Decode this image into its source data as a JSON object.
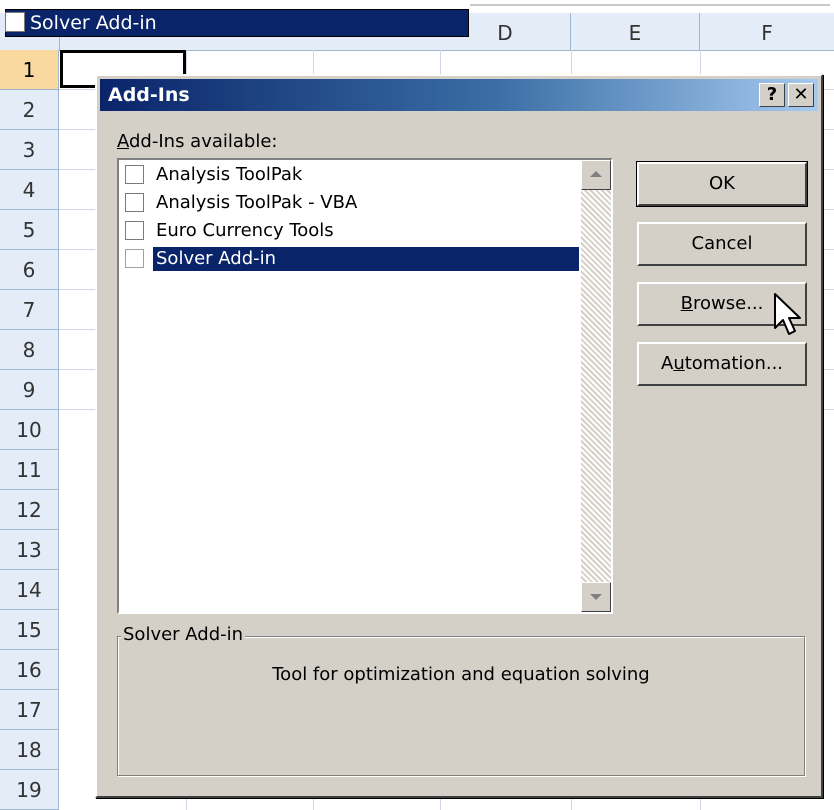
{
  "drag_label": {
    "text": "Solver Add-in"
  },
  "sheet": {
    "columns": [
      "D",
      "E",
      "F"
    ],
    "rows": [
      "1",
      "2",
      "3",
      "4",
      "5",
      "6",
      "7",
      "8",
      "9",
      "10",
      "11",
      "12",
      "13",
      "14",
      "15",
      "16",
      "17",
      "18",
      "19"
    ]
  },
  "dialog": {
    "title": "Add-Ins",
    "help_glyph": "?",
    "close_glyph": "✕",
    "list_label_access": "A",
    "list_label_rest": "dd-Ins available:",
    "items": [
      {
        "label": "Analysis ToolPak",
        "checked": false
      },
      {
        "label": "Analysis ToolPak - VBA",
        "checked": false
      },
      {
        "label": "Euro Currency Tools",
        "checked": false
      },
      {
        "label": "Solver Add-in",
        "checked": false,
        "selected": true
      }
    ],
    "buttons": {
      "ok": "OK",
      "cancel": "Cancel",
      "browse_access": "B",
      "browse_rest": "rowse...",
      "automation_pre": "A",
      "automation_access": "u",
      "automation_rest": "tomation..."
    },
    "group": {
      "title": "Solver Add-in",
      "description": "Tool for optimization and equation solving"
    }
  }
}
